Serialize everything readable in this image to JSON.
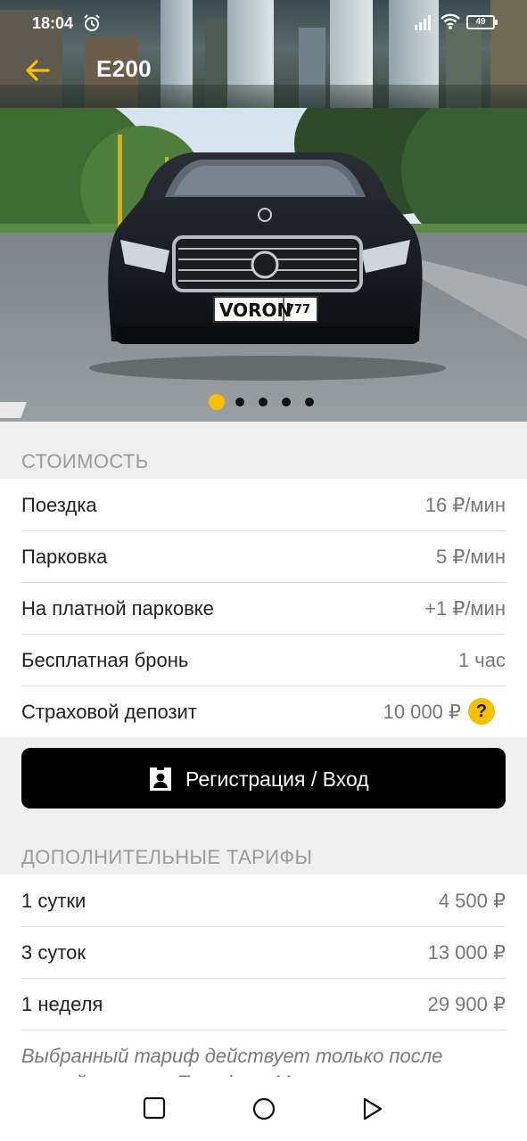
{
  "status_bar": {
    "time": "18:04",
    "battery": "49"
  },
  "header": {
    "title": "E200"
  },
  "gallery": {
    "total": 5,
    "active_index": 0,
    "plate": "VORON",
    "plate_number": "777"
  },
  "cost": {
    "section_title": "СТОИМОСТЬ",
    "rows": [
      {
        "label": "Поездка",
        "value": "16 ₽/мин"
      },
      {
        "label": "Парковка",
        "value": "5 ₽/мин"
      },
      {
        "label": "На платной парковке",
        "value": "+1 ₽/мин"
      },
      {
        "label": "Бесплатная бронь",
        "value": "1 час"
      },
      {
        "label": "Страховой депозит",
        "value": "10 000 ₽",
        "help": "?"
      }
    ]
  },
  "register_button": {
    "label": "Регистрация / Вход"
  },
  "tariffs": {
    "section_title": "ДОПОЛНИТЕЛЬНЫЕ ТАРИФЫ",
    "rows": [
      {
        "label": "1 сутки",
        "value": "4 500 ₽"
      },
      {
        "label": "3 суток",
        "value": "13 000 ₽"
      },
      {
        "label": "1 неделя",
        "value": "29 900 ₽"
      }
    ]
  },
  "note": "Выбранный тариф действует только после полной оплаты. Тарифы и Московских",
  "colors": {
    "accent": "#f6c000",
    "button_bg": "#000000"
  },
  "icons": [
    "back-arrow-icon",
    "alarm-icon",
    "signal-icon",
    "wifi-icon",
    "battery-icon",
    "help-icon",
    "person-badge-icon",
    "nav-square-icon",
    "nav-circle-icon",
    "nav-triangle-icon"
  ]
}
